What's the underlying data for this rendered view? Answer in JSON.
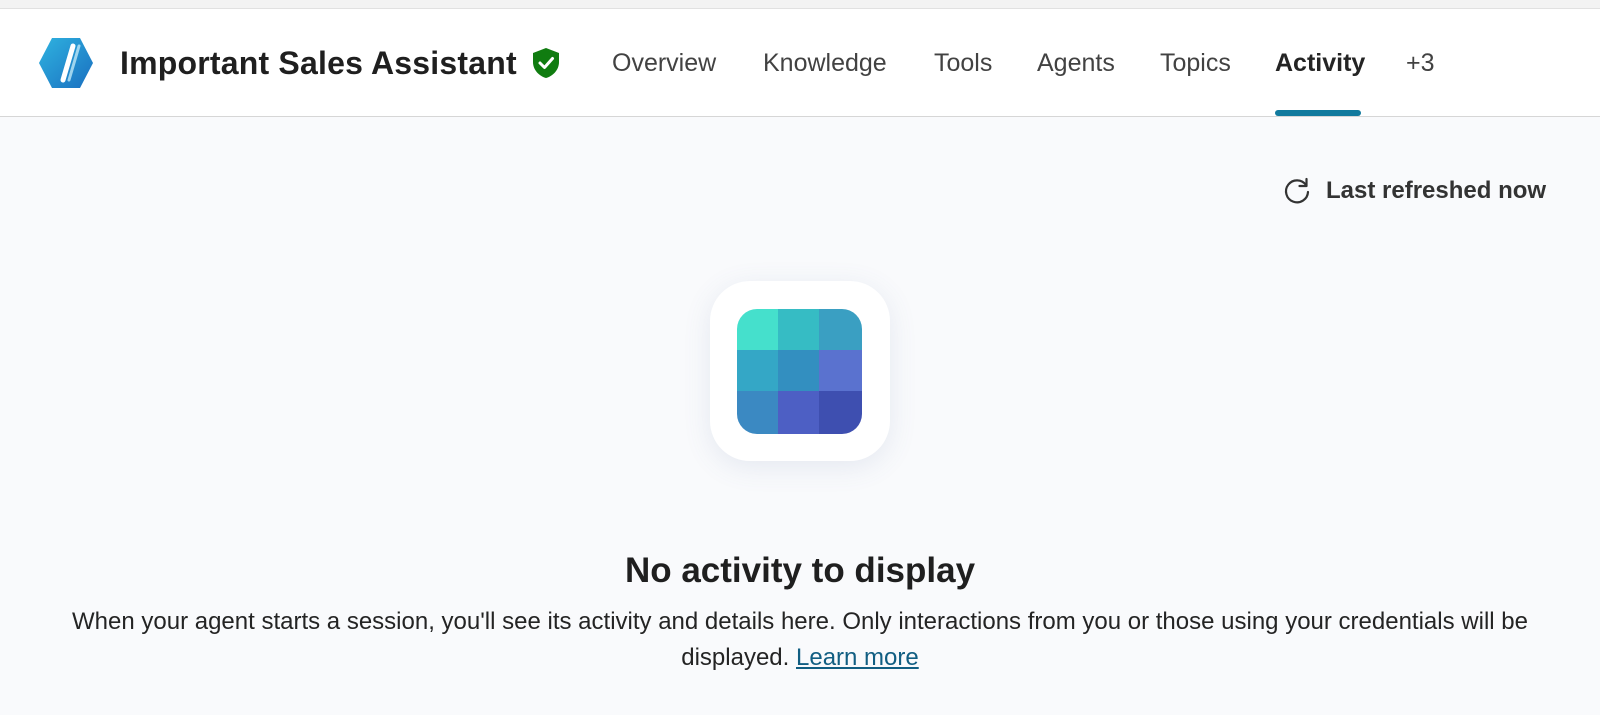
{
  "header": {
    "agent_name": "Important Sales Assistant",
    "logo_icon": "agent-logo-icon",
    "verified_icon": "verified-shield-icon",
    "tabs": [
      {
        "label": "Overview",
        "active": false
      },
      {
        "label": "Knowledge",
        "active": false
      },
      {
        "label": "Tools",
        "active": false
      },
      {
        "label": "Agents",
        "active": false
      },
      {
        "label": "Topics",
        "active": false
      },
      {
        "label": "Activity",
        "active": true
      },
      {
        "label": "+3",
        "active": false
      }
    ]
  },
  "toolbar": {
    "refresh_icon": "refresh-icon",
    "refresh_label": "Last refreshed now"
  },
  "empty_state": {
    "icon": "activity-grid-icon",
    "title": "No activity to display",
    "description": "When your agent starts a session, you'll see its activity and details here. Only interactions from you or those using your credentials will be displayed.",
    "link_label": "Learn more"
  },
  "colors": {
    "accent": "#117a9e",
    "verified": "#107c10",
    "link": "#115e82"
  }
}
